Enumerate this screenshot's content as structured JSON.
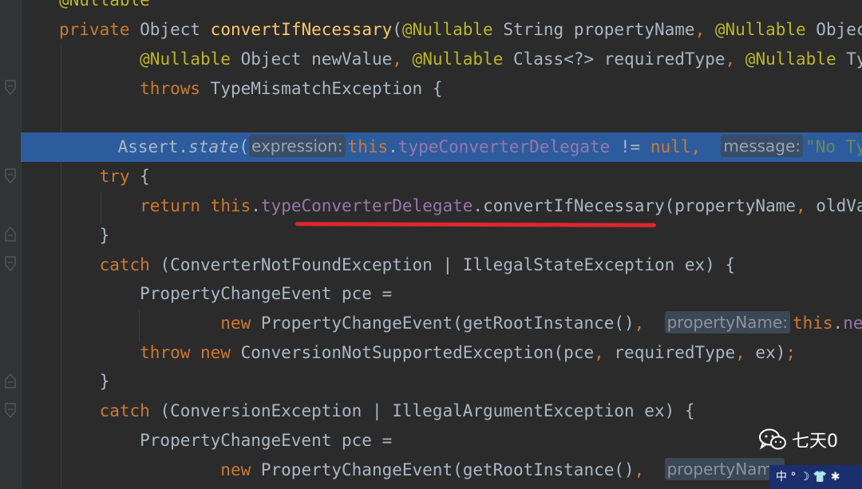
{
  "editor": {
    "lines": [
      {
        "id": "l0",
        "tokens": [
          {
            "t": "@Nullable",
            "c": "ann"
          }
        ]
      },
      {
        "id": "l1",
        "tokens": [
          {
            "t": "private ",
            "c": "kw"
          },
          {
            "t": "Object "
          },
          {
            "t": "convertIfNecessary",
            "c": "mth"
          },
          {
            "t": "("
          },
          {
            "t": "@Nullable ",
            "c": "ann"
          },
          {
            "t": "String propertyName"
          },
          {
            "t": ", ",
            "c": "kw"
          },
          {
            "t": "@Nullable ",
            "c": "ann"
          },
          {
            "t": "Object o"
          }
        ]
      },
      {
        "id": "l2",
        "tokens": [
          {
            "t": "        "
          },
          {
            "t": "@Nullable ",
            "c": "ann"
          },
          {
            "t": "Object newValue"
          },
          {
            "t": ", ",
            "c": "kw"
          },
          {
            "t": "@Nullable ",
            "c": "ann"
          },
          {
            "t": "Class<?> requiredType"
          },
          {
            "t": ", ",
            "c": "kw"
          },
          {
            "t": "@Nullable ",
            "c": "ann"
          },
          {
            "t": "TypeDesc"
          }
        ]
      },
      {
        "id": "l3",
        "tokens": [
          {
            "t": "        "
          },
          {
            "t": "throws ",
            "c": "kw"
          },
          {
            "t": "TypeMismatchException {"
          }
        ]
      },
      {
        "id": "l4",
        "tokens": []
      },
      {
        "id": "l5",
        "current": true,
        "tokens": [
          {
            "t": "    Assert."
          },
          {
            "t": "state",
            "c": "it"
          },
          {
            "t": "("
          },
          {
            "t": "expression:",
            "c": "hint"
          },
          {
            "t": "this",
            "c": "kw"
          },
          {
            "t": "."
          },
          {
            "t": "typeConverterDelegate",
            "c": "fld"
          },
          {
            "t": " != "
          },
          {
            "t": "null",
            "c": "kw"
          },
          {
            "t": ",  ",
            "c": "kw"
          },
          {
            "t": "message:",
            "c": "hint"
          },
          {
            "t": "\"No TypeCon",
            "c": "str"
          }
        ]
      },
      {
        "id": "l6",
        "tokens": [
          {
            "t": "    "
          },
          {
            "t": "try ",
            "c": "kw"
          },
          {
            "t": "{"
          }
        ]
      },
      {
        "id": "l7",
        "tokens": [
          {
            "t": "        "
          },
          {
            "t": "return ",
            "c": "kw"
          },
          {
            "t": "this",
            "c": "kw"
          },
          {
            "t": "."
          },
          {
            "t": "typeConverterDelegate",
            "c": "fld"
          },
          {
            "t": ".convertIfNecessary(propertyName"
          },
          {
            "t": ", ",
            "c": "kw"
          },
          {
            "t": "oldValue"
          }
        ]
      },
      {
        "id": "l8",
        "tokens": [
          {
            "t": "    }"
          }
        ]
      },
      {
        "id": "l9",
        "tokens": [
          {
            "t": "    "
          },
          {
            "t": "catch ",
            "c": "kw"
          },
          {
            "t": "(ConverterNotFoundException | IllegalStateException ex) {"
          }
        ]
      },
      {
        "id": "l10",
        "tokens": [
          {
            "t": "        PropertyChangeEvent pce ="
          }
        ]
      },
      {
        "id": "l11",
        "tokens": [
          {
            "t": "                "
          },
          {
            "t": "new ",
            "c": "kw"
          },
          {
            "t": "PropertyChangeEvent(getRootInstance()"
          },
          {
            "t": ",  ",
            "c": "kw"
          },
          {
            "t": "propertyName:",
            "c": "hint"
          },
          {
            "t": "this",
            "c": "kw"
          },
          {
            "t": "."
          },
          {
            "t": "nestedPa",
            "c": "fld"
          }
        ]
      },
      {
        "id": "l12",
        "tokens": [
          {
            "t": "        "
          },
          {
            "t": "throw new ",
            "c": "kw"
          },
          {
            "t": "ConversionNotSupportedException(pce"
          },
          {
            "t": ", ",
            "c": "kw"
          },
          {
            "t": "requiredType"
          },
          {
            "t": ", ",
            "c": "kw"
          },
          {
            "t": "ex)"
          },
          {
            "t": ";",
            "c": "kw"
          }
        ]
      },
      {
        "id": "l13",
        "tokens": [
          {
            "t": "    }"
          }
        ]
      },
      {
        "id": "l14",
        "tokens": [
          {
            "t": "    "
          },
          {
            "t": "catch ",
            "c": "kw"
          },
          {
            "t": "(ConversionException | IllegalArgumentException ex) {"
          }
        ]
      },
      {
        "id": "l15",
        "tokens": [
          {
            "t": "        PropertyChangeEvent pce ="
          }
        ]
      },
      {
        "id": "l16",
        "tokens": [
          {
            "t": "                "
          },
          {
            "t": "new ",
            "c": "kw"
          },
          {
            "t": "PropertyChangeEvent(getRootInstance()"
          },
          {
            "t": ",  ",
            "c": "kw"
          },
          {
            "t": "propertyName",
            "c": "hint"
          }
        ]
      }
    ]
  },
  "colors": {
    "background": "#2b2b2b",
    "keyword": "#cc7832",
    "annotation": "#bbb529",
    "method": "#ffc66d",
    "field": "#9876aa",
    "string": "#6a8759",
    "current_line": "#2d5c9e",
    "underline": "#e0262e"
  },
  "watermark": {
    "icon": "wechat-icon",
    "text": "七天0",
    "badge": "中 ° ☽ 👕 ✱"
  }
}
